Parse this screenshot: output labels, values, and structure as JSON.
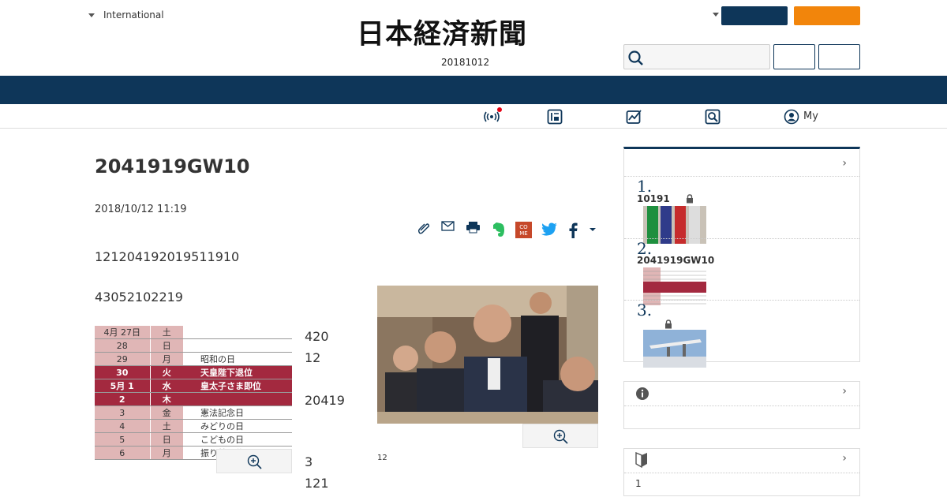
{
  "header": {
    "edition_label": "International",
    "logo_text": "日本経済新聞",
    "date_code": "20181012",
    "search": {
      "placeholder": ""
    },
    "colors": {
      "navy": "#0e3659",
      "orange": "#f2850b"
    }
  },
  "subnav": {
    "icons": [
      "broadcast-icon",
      "newspaper-icon",
      "chart-icon",
      "search-icon",
      "user-icon"
    ],
    "my_label": "My"
  },
  "article": {
    "title": "2041919GW10",
    "published": "2018/10/12 11:19",
    "paragraph1": "121204192019511910",
    "paragraph2": "43052102219",
    "side_numbers": [
      "420",
      "12",
      "20419",
      "3",
      "121"
    ],
    "photo_caption": "12",
    "share_icons": [
      "clip-icon",
      "mail-icon",
      "print-icon",
      "evernote-icon",
      "come-icon",
      "twitter-icon",
      "facebook-icon",
      "more-caret-icon"
    ],
    "calendar": [
      {
        "date": "4月  27日",
        "day": "土",
        "note": "",
        "highlight": false
      },
      {
        "date": "28",
        "day": "日",
        "note": "",
        "highlight": false
      },
      {
        "date": "29",
        "day": "月",
        "note": "昭和の日",
        "highlight": false
      },
      {
        "date": "30",
        "day": "火",
        "note": "天皇陛下退位",
        "highlight": true
      },
      {
        "date": "5月    1",
        "day": "水",
        "note": "皇太子さま即位",
        "highlight": true
      },
      {
        "date": "2",
        "day": "木",
        "note": "",
        "highlight": true
      },
      {
        "date": "3",
        "day": "金",
        "note": "憲法記念日",
        "highlight": false
      },
      {
        "date": "4",
        "day": "土",
        "note": "みどりの日",
        "highlight": false
      },
      {
        "date": "5",
        "day": "日",
        "note": "こどもの日",
        "highlight": false
      },
      {
        "date": "6",
        "day": "月",
        "note": "振り替え休日",
        "highlight": false
      }
    ]
  },
  "sidebar": {
    "ranking": [
      {
        "num": "1.",
        "title": "10191",
        "locked": true
      },
      {
        "num": "2.",
        "title": "2041919GW10",
        "locked": false
      },
      {
        "num": "3.",
        "title": "",
        "locked": true
      }
    ],
    "box3_item": "1"
  }
}
